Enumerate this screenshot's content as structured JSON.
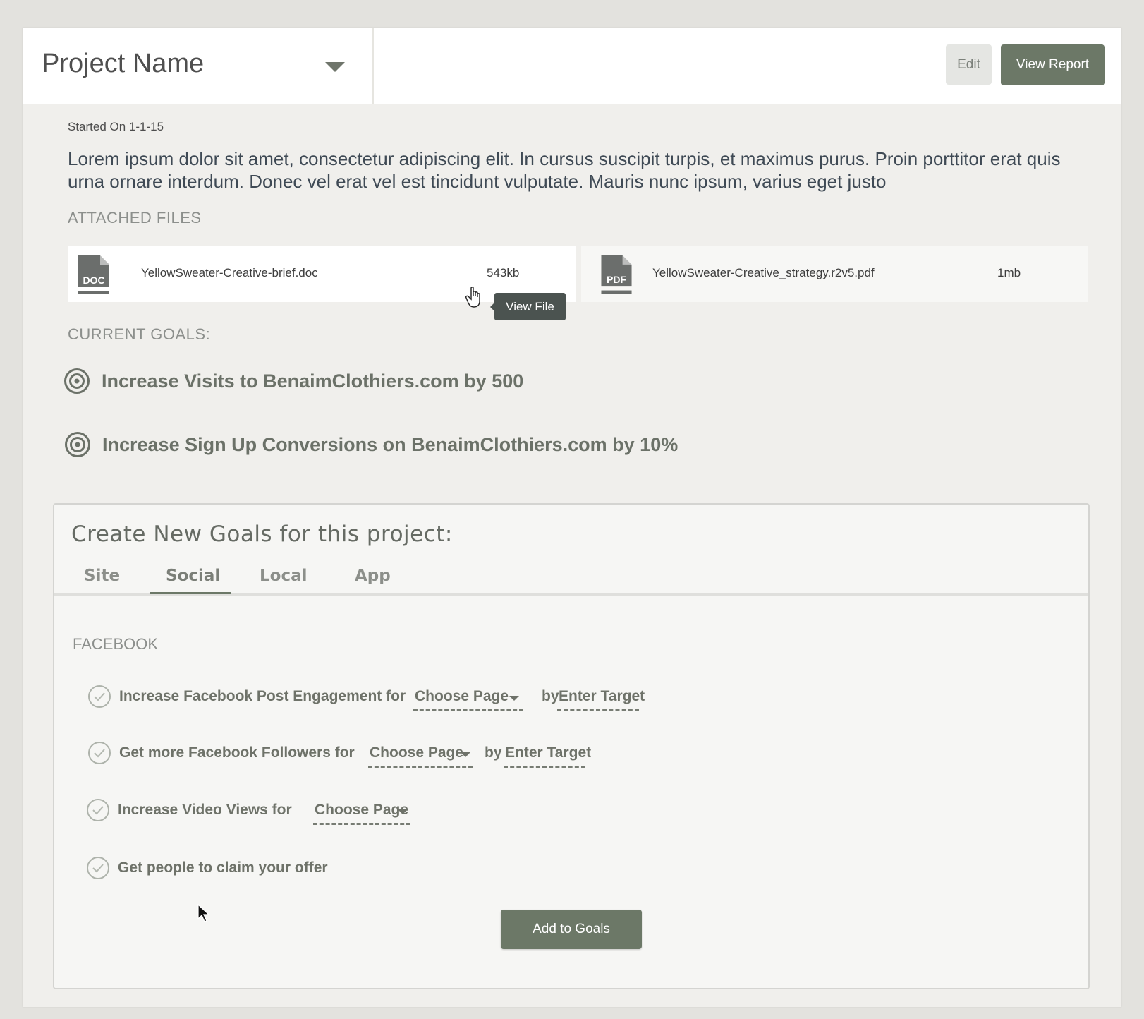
{
  "header": {
    "project_name": "Project Name",
    "edit_label": "Edit",
    "view_report_label": "View Report"
  },
  "project": {
    "started_on": "Started On 1-1-15",
    "description": "Lorem ipsum dolor sit amet, consectetur adipiscing elit. In cursus suscipit turpis, et maximus purus. Proin porttitor erat quis urna ornare interdum. Donec vel erat vel est tincidunt vulputate. Mauris nunc ipsum, varius eget justo"
  },
  "attached_files": {
    "label": "ATTACHED FILES",
    "files": [
      {
        "type": "DOC",
        "name": "YellowSweater-Creative-brief.doc",
        "size": "543kb",
        "icon": "doc-file-icon"
      },
      {
        "type": "PDF",
        "name": "YellowSweater-Creative_strategy.r2v5.pdf",
        "size": "1mb",
        "icon": "pdf-file-icon"
      }
    ],
    "tooltip": "View File"
  },
  "current_goals": {
    "label": "CURRENT GOALS:",
    "items": [
      {
        "text": "Increase Visits to BenaimClothiers.com by 500",
        "icon": "target-icon"
      },
      {
        "text": "Increase Sign Up Conversions on BenaimClothiers.com by 10%",
        "icon": "target-icon"
      }
    ]
  },
  "create_goals": {
    "title": "Create New Goals for this project:",
    "tabs": [
      {
        "label": "Site",
        "active": false
      },
      {
        "label": "Social",
        "active": true
      },
      {
        "label": "Local",
        "active": false
      },
      {
        "label": "App",
        "active": false
      }
    ],
    "section_label": "FACEBOOK",
    "options": [
      {
        "text": "Increase Facebook Post Engagement for",
        "page_placeholder": "Choose Page",
        "by": "by",
        "target_placeholder": "Enter Target"
      },
      {
        "text": "Get more Facebook Followers for",
        "page_placeholder": "Choose Page",
        "by": "by",
        "target_placeholder": "Enter Target"
      },
      {
        "text": "Increase Video Views for",
        "page_placeholder": "Choose Page"
      },
      {
        "text": "Get people to claim your offer"
      }
    ],
    "add_button": "Add to Goals"
  },
  "colors": {
    "accent": "#6c7867",
    "background": "#e3e2de",
    "panel": "#f0efec"
  }
}
